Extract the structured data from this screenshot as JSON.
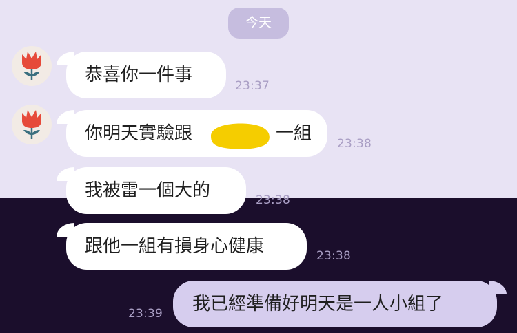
{
  "chat": {
    "date_label": "今天",
    "messages": [
      {
        "text": "恭喜你一件事",
        "time": "23:37"
      },
      {
        "text_before": "你明天實驗跟",
        "text_after": "一組",
        "time": "23:38"
      },
      {
        "text": "我被雷一個大的",
        "time": "23:38"
      },
      {
        "text": "跟他一組有損身心健康",
        "time": "23:38"
      },
      {
        "text": "我已經準備好明天是一人小組了",
        "time": "23:39"
      }
    ]
  },
  "icons": {
    "avatar": "red-tulip-avatar-icon"
  },
  "colors": {
    "chat_bg_light": "#e8e3f4",
    "chat_bg_dark": "#1b0e2c",
    "incoming_bubble": "#ffffff",
    "outgoing_bubble": "#d6cdee",
    "date_chip": "#c6bddf",
    "timestamp": "#a99ec4",
    "redaction_highlight": "#f5cd00"
  }
}
